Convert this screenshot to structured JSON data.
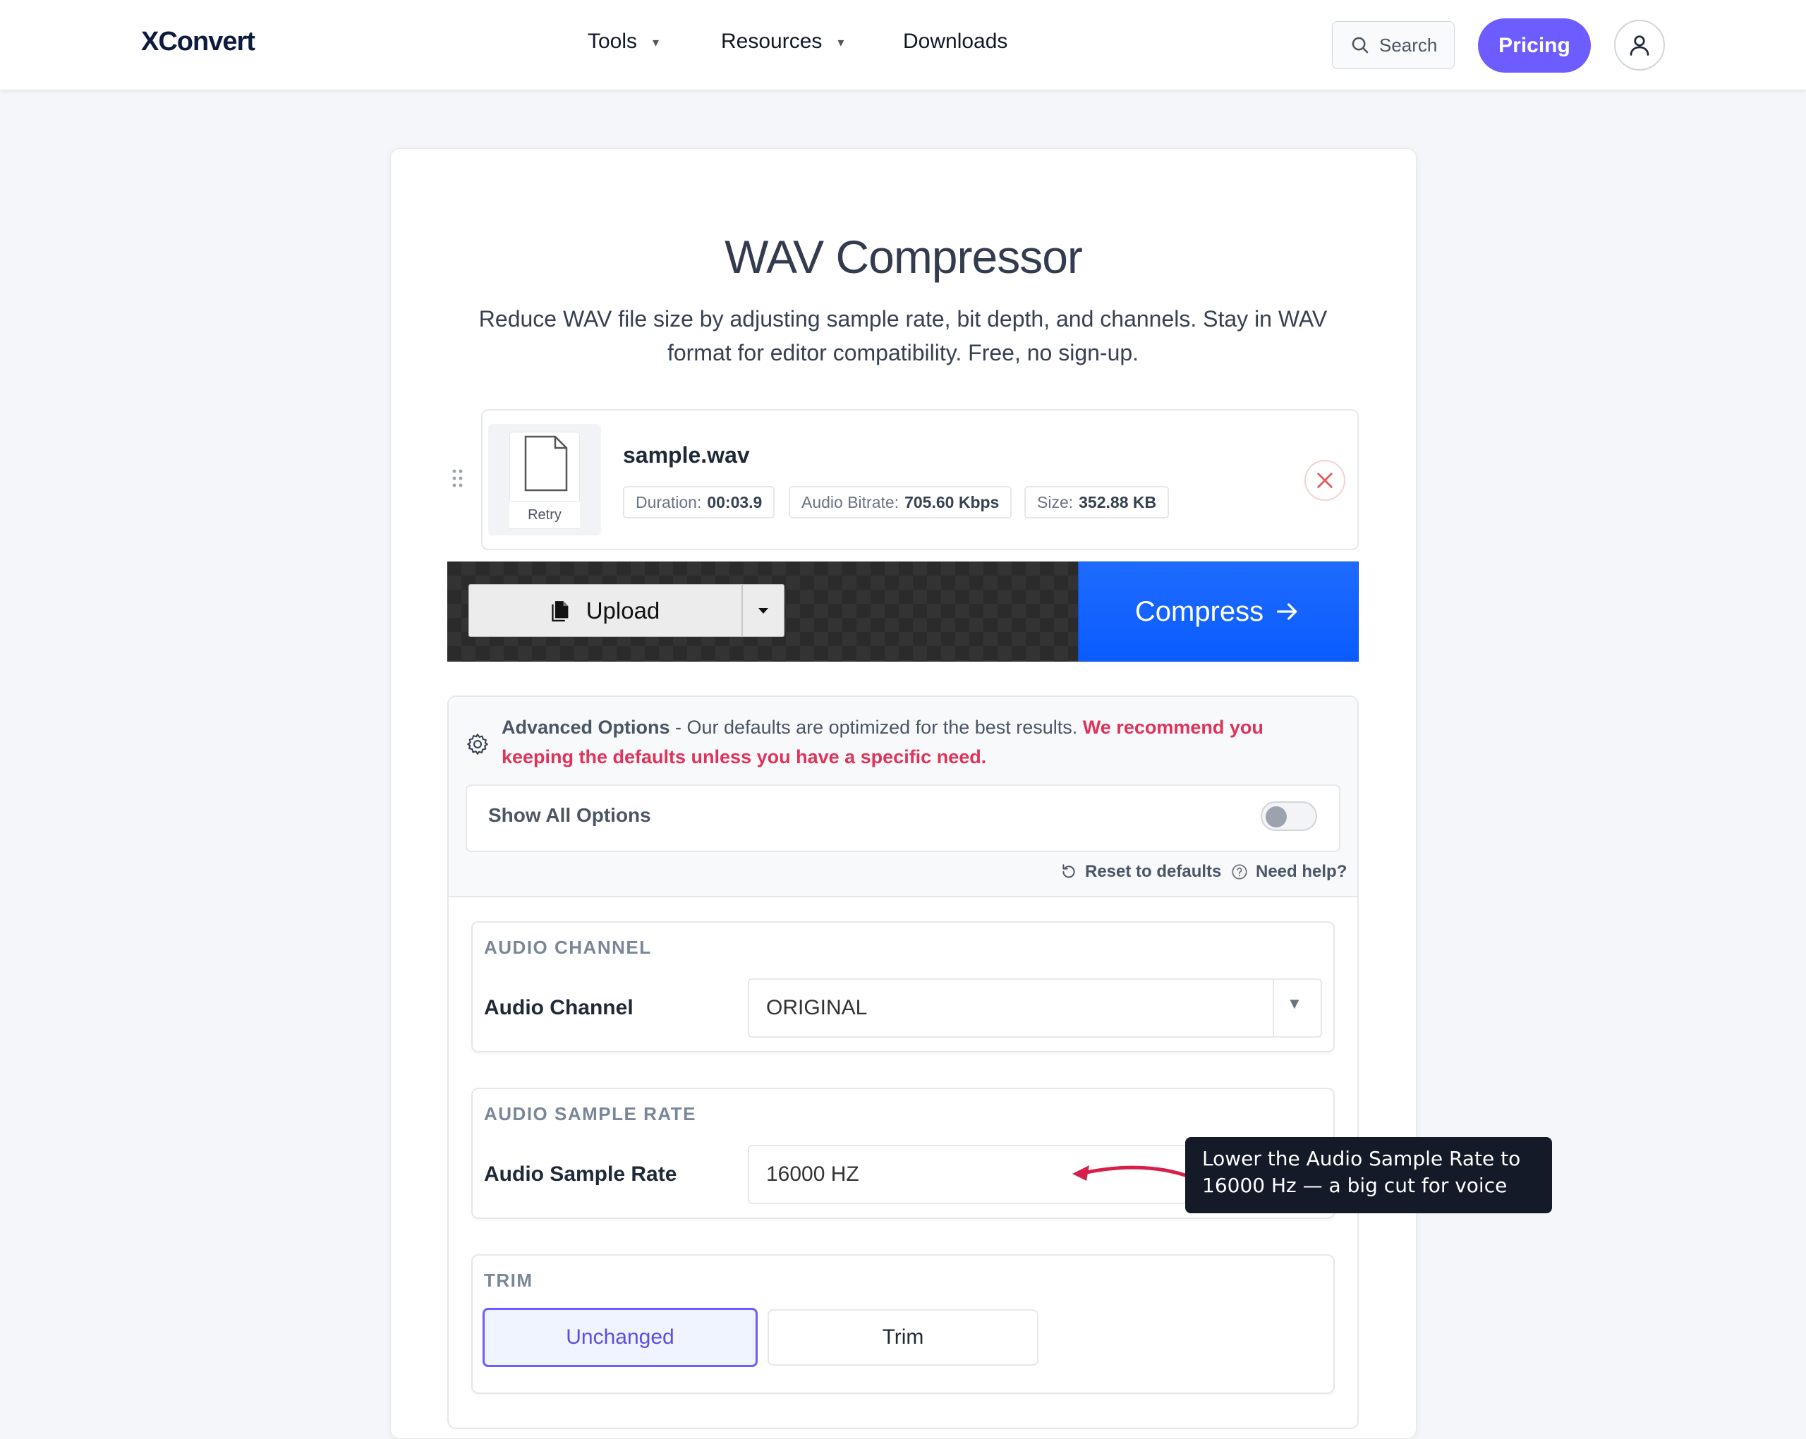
{
  "header": {
    "logo": "XConvert",
    "nav": [
      {
        "label": "Tools",
        "has_caret": true
      },
      {
        "label": "Resources",
        "has_caret": true
      },
      {
        "label": "Downloads",
        "has_caret": false
      }
    ],
    "search_label": "Search",
    "pricing_label": "Pricing",
    "caret": "▾"
  },
  "page": {
    "title": "WAV Compressor",
    "subtitle": "Reduce WAV file size by adjusting sample rate, bit depth, and channels. Stay in WAV format for editor compatibility. Free, no sign-up."
  },
  "file": {
    "name": "sample.wav",
    "retry_label": "Retry",
    "chips": [
      {
        "key": "Duration:",
        "value": "00:03.9"
      },
      {
        "key": "Audio Bitrate:",
        "value": "705.60 Kbps"
      },
      {
        "key": "Size:",
        "value": "352.88 KB"
      }
    ]
  },
  "actions": {
    "upload_label": "Upload",
    "compress_label": "Compress"
  },
  "advanced": {
    "heading": "Advanced Options",
    "text": " - Our defaults are optimized for the best results. ",
    "recommend": "We recommend you keeping the defaults unless you have a specific need.",
    "show_all_label": "Show All Options",
    "show_all_on": false,
    "reset_label": "Reset to defaults",
    "help_label": "Need help?"
  },
  "sections": {
    "channel": {
      "heading": "AUDIO CHANNEL",
      "label": "Audio Channel",
      "value": "ORIGINAL"
    },
    "sample_rate": {
      "heading": "AUDIO SAMPLE RATE",
      "label": "Audio Sample Rate",
      "value": "16000 HZ"
    },
    "trim": {
      "heading": "TRIM",
      "options": [
        "Unchanged",
        "Trim"
      ],
      "selected": "Unchanged"
    }
  },
  "tooltip": {
    "text": "Lower the Audio Sample Rate to 16000 Hz — a big cut for voice"
  },
  "colors": {
    "accent": "#6d5cff",
    "compress_blue": "#0a5cff",
    "warning_red": "#e0335a",
    "tooltip_bg": "#141a28",
    "arrow": "#d6204b"
  }
}
